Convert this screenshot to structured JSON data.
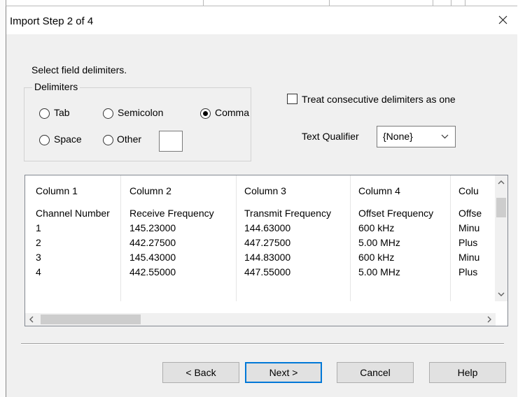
{
  "dialog": {
    "title": "Import Step 2 of 4",
    "close_glyph": "close-icon"
  },
  "instruction": "Select field delimiters.",
  "delimiters": {
    "legend": "Delimiters",
    "options": [
      {
        "label": "Tab",
        "checked": false
      },
      {
        "label": "Semicolon",
        "checked": false
      },
      {
        "label": "Comma",
        "checked": true
      },
      {
        "label": "Space",
        "checked": false
      },
      {
        "label": "Other",
        "checked": false
      }
    ],
    "other_value": ""
  },
  "treat_consecutive": {
    "label": "Treat consecutive delimiters as one",
    "checked": false
  },
  "text_qualifier": {
    "label": "Text Qualifier",
    "value": "{None}"
  },
  "preview": {
    "headers": [
      "Column 1",
      "Column 2",
      "Column 3",
      "Column 4",
      "Colu"
    ],
    "rows": [
      [
        "Channel Number",
        "Receive Frequency",
        "Transmit Frequency",
        "Offset Frequency",
        "Offse"
      ],
      [
        "1",
        "145.23000",
        "144.63000",
        "600 kHz",
        "Minu"
      ],
      [
        "2",
        "442.27500",
        "447.27500",
        "5.00 MHz",
        "Plus"
      ],
      [
        "3",
        "145.43000",
        "144.83000",
        "600 kHz",
        "Minu"
      ],
      [
        "4",
        "442.55000",
        "447.55000",
        "5.00 MHz",
        "Plus"
      ]
    ]
  },
  "buttons": {
    "back": "< Back",
    "next": "Next >",
    "cancel": "Cancel",
    "help": "Help"
  },
  "colors": {
    "dialog_bg": "#f0f0f0",
    "default_button_border": "#0078d7",
    "scroll_thumb": "#cdcdcd"
  }
}
